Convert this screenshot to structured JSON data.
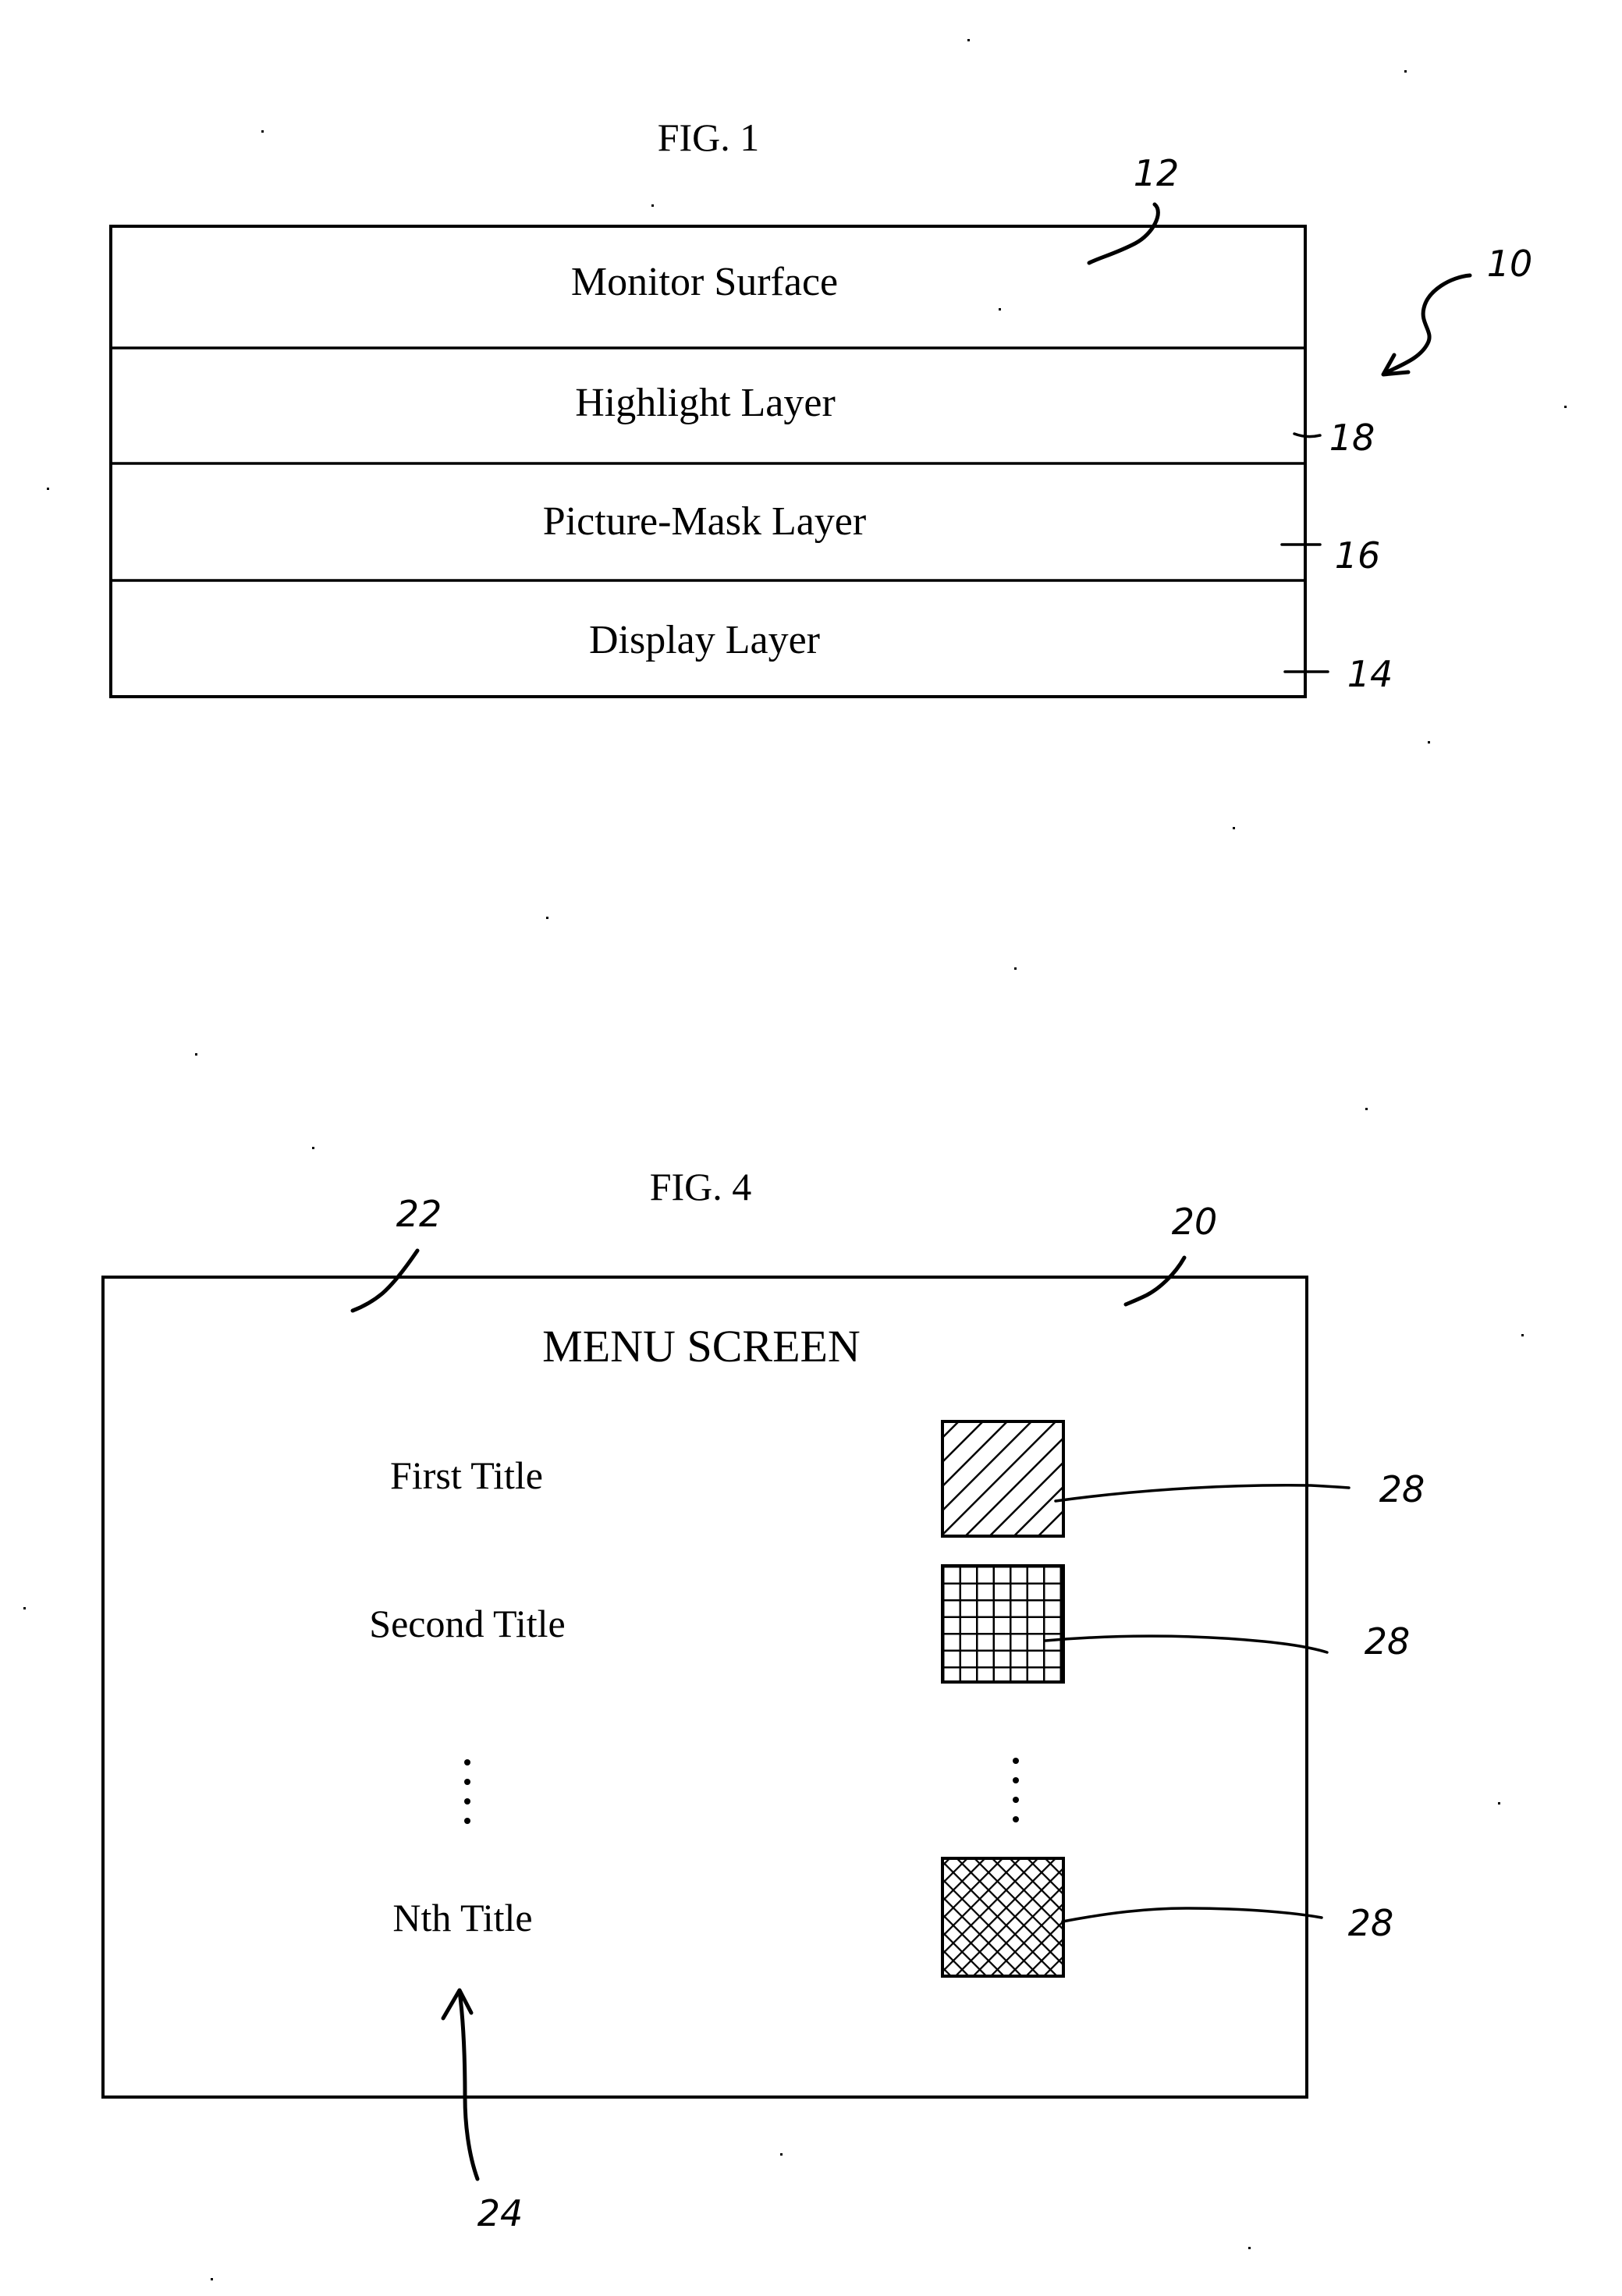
{
  "figure1": {
    "title": "FIG. 1",
    "layers": [
      {
        "label": "Monitor Surface",
        "ref": "12"
      },
      {
        "label": "Highlight Layer",
        "ref": "18"
      },
      {
        "label": "Picture-Mask Layer",
        "ref": "16"
      },
      {
        "label": "Display Layer",
        "ref": "14"
      }
    ],
    "assembly_ref": "10"
  },
  "figure4": {
    "title": "FIG. 4",
    "screen_title": "MENU SCREEN",
    "screen_ref": "20",
    "region_ref": "22",
    "titles_ref": "24",
    "items": [
      {
        "label": "First Title",
        "button_pattern": "diagonal-hatch",
        "ref": "28"
      },
      {
        "label": "Second Title",
        "button_pattern": "square-grid",
        "ref": "28"
      },
      {
        "label": "Nth Title",
        "button_pattern": "diamond-crosshatch",
        "ref": "28"
      }
    ],
    "ellipsis": "vertical-dots"
  }
}
